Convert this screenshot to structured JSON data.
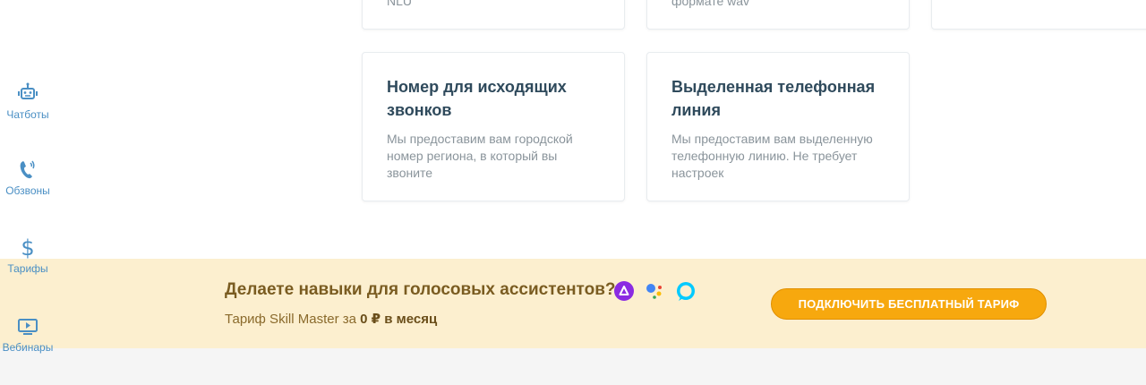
{
  "sidebar": {
    "items": [
      {
        "label": "Чатботы",
        "icon": "robot-icon"
      },
      {
        "label": "Обзвоны",
        "icon": "phone-call-icon"
      },
      {
        "label": "Тарифы",
        "icon": "dollar-icon"
      },
      {
        "label": "Вебинары",
        "icon": "video-play-icon"
      }
    ]
  },
  "top_cards": [
    {
      "fragment": "NLU"
    },
    {
      "fragment": "формате wav"
    }
  ],
  "cards": [
    {
      "title": "Номер для исходящих звонков",
      "description": "Мы предоставим вам городской номер региона, в который вы звоните"
    },
    {
      "title": "Выделенная телефонная линия",
      "description": "Мы предоставим вам выделенную телефонную линию. Не требует настроек"
    }
  ],
  "banner": {
    "title": "Делаете навыки для голосовых ассистентов?",
    "subtitle_prefix": "Тариф Skill Master за ",
    "subtitle_price": "0 ₽ в месяц",
    "cta_label": "ПОДКЛЮЧИТЬ БЕСПЛАТНЫЙ ТАРИФ",
    "assistants": [
      "alice-icon",
      "google-assistant-icon",
      "alexa-icon"
    ]
  },
  "colors": {
    "accent_blue": "#4a8fc4",
    "banner_bg": "#fcefcf",
    "cta_bg": "#f7a80e",
    "title_text": "#2f4a5c"
  }
}
